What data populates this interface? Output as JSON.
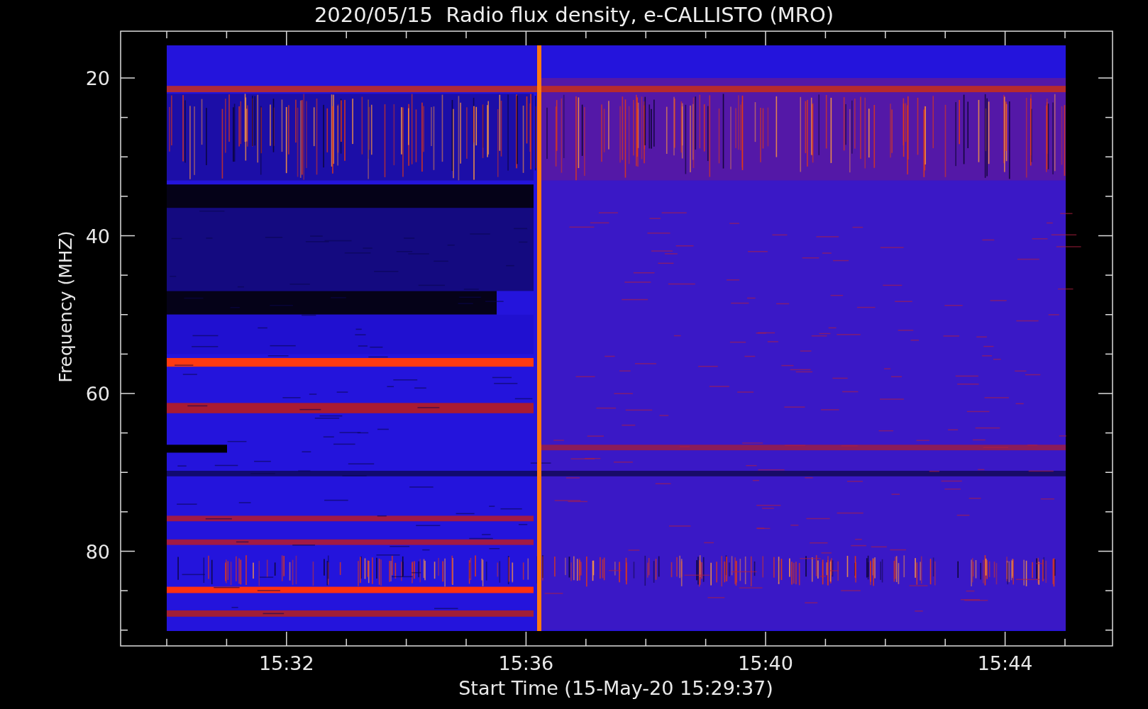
{
  "title": "2020/05/15  Radio flux density, e-CALLISTO (MRO)",
  "y_axis": {
    "label": "Frequency (MHZ)",
    "ticks": [
      "20",
      "40",
      "60",
      "80"
    ]
  },
  "x_axis": {
    "label": "Start Time (15-May-20 15:29:37)",
    "ticks": [
      "15:32",
      "15:36",
      "15:40",
      "15:44"
    ]
  }
}
